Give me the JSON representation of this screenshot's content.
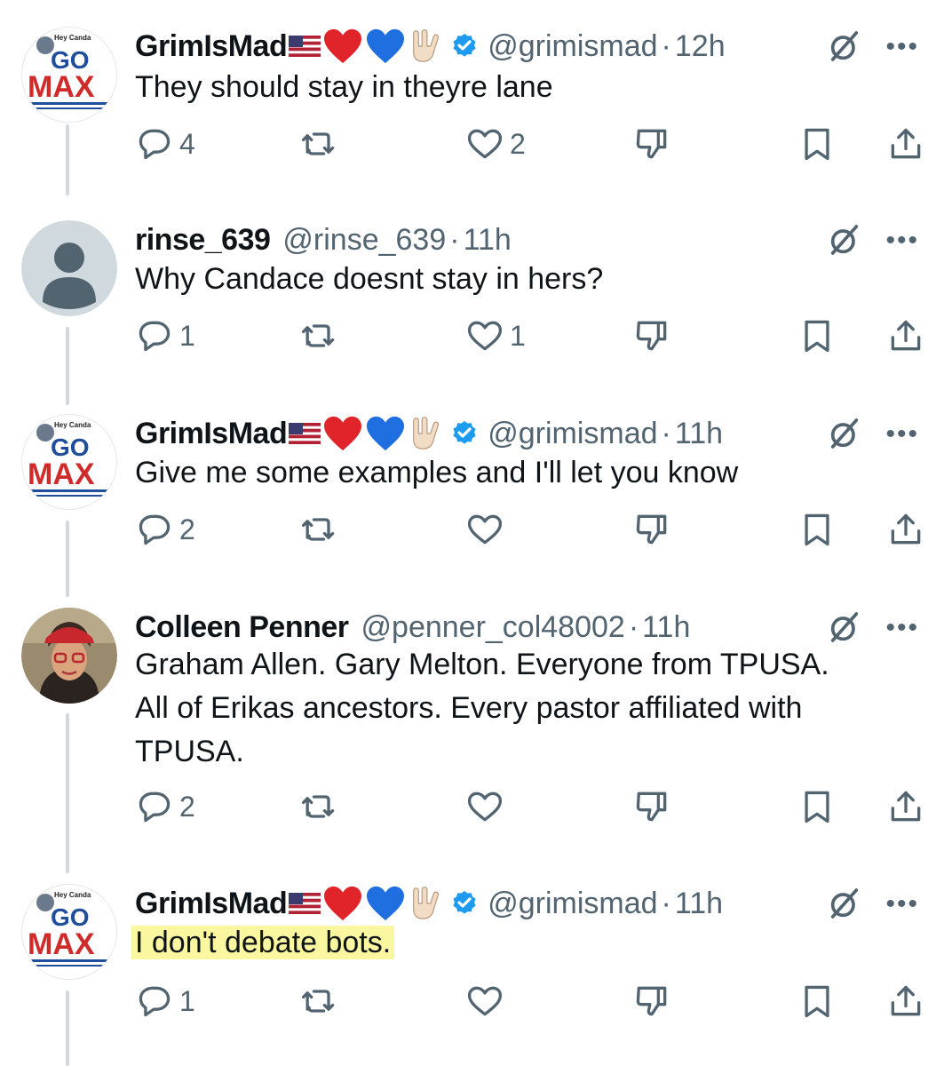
{
  "tweets": [
    {
      "name": "GrimIsMad",
      "handle": "@grimismad",
      "dot": "·",
      "time": "12h",
      "text": "They should stay in theyre lane",
      "verified": true,
      "highlight": false,
      "avatar": {
        "type": "gomax",
        "line1": "Hey Canda",
        "line2": "GO",
        "line3": "MAX"
      },
      "counts": {
        "reply": "4",
        "retweet": "",
        "like": "2"
      }
    },
    {
      "name": "rinse_639",
      "handle": "@rinse_639",
      "dot": "·",
      "time": "11h",
      "text": "Why Candace doesnt stay in hers?",
      "verified": false,
      "highlight": false,
      "avatar": {
        "type": "default"
      },
      "counts": {
        "reply": "1",
        "retweet": "",
        "like": "1"
      }
    },
    {
      "name": "GrimIsMad",
      "handle": "@grimismad",
      "dot": "·",
      "time": "11h",
      "text": "Give me some examples and I'll let you know",
      "verified": true,
      "highlight": false,
      "avatar": {
        "type": "gomax",
        "line1": "Hey Canda",
        "line2": "GO",
        "line3": "MAX"
      },
      "counts": {
        "reply": "2",
        "retweet": "",
        "like": ""
      }
    },
    {
      "name": "Colleen Penner",
      "handle": "@penner_col48002",
      "dot": "·",
      "time": "11h",
      "text_lines": [
        "Graham Allen.  Gary Melton. Everyone from TPUSA.",
        "All of Erikas ancestors.  Every pastor affiliated with",
        "TPUSA."
      ],
      "verified": false,
      "highlight": false,
      "avatar": {
        "type": "photo"
      },
      "counts": {
        "reply": "2",
        "retweet": "",
        "like": ""
      }
    },
    {
      "name": "GrimIsMad",
      "handle": "@grimismad",
      "dot": "·",
      "time": "11h",
      "text": "I don't debate bots.",
      "verified": true,
      "highlight": true,
      "avatar": {
        "type": "gomax",
        "line1": "Hey Canda",
        "line2": "GO",
        "line3": "MAX"
      },
      "counts": {
        "reply": "1",
        "retweet": "",
        "like": ""
      }
    }
  ],
  "icons": {
    "reply": "reply-icon",
    "retweet": "retweet-icon",
    "like": "heart-icon",
    "downvote": "downvote-icon",
    "bookmark": "bookmark-icon",
    "share": "share-icon",
    "grok": "grok-icon",
    "more": "more-icon",
    "verified": "verified-badge-icon"
  },
  "colors": {
    "text": "#0f1419",
    "muted": "#536471",
    "verified": "#1d9bf0",
    "highlight": "#fbf7a0",
    "thread_line": "#cfd9de"
  }
}
